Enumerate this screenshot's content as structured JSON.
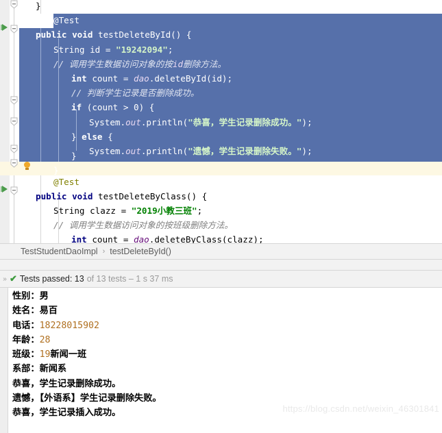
{
  "editor": {
    "lines": [
      {
        "y": -2,
        "indent": 52,
        "selected": false,
        "tokens": [
          {
            "c": "plain",
            "t": "}"
          }
        ]
      },
      {
        "y": 19.2,
        "indent": 78,
        "selected": true,
        "selstart": 78,
        "tokens": [
          {
            "c": "anno",
            "t": "@Test"
          }
        ]
      },
      {
        "y": 40.4,
        "indent": 52,
        "selected": true,
        "tokens": [
          {
            "c": "kw",
            "t": "public void "
          },
          {
            "c": "plain",
            "t": "testDeleteById() {"
          }
        ]
      },
      {
        "y": 61.6,
        "indent": 78,
        "selected": true,
        "tokens": [
          {
            "c": "plain",
            "t": "String id = "
          },
          {
            "c": "str",
            "t": "\"19242094\""
          },
          {
            "c": "plain",
            "t": ";"
          }
        ]
      },
      {
        "y": 82.8,
        "indent": 78,
        "selected": true,
        "tokens": [
          {
            "c": "cmt",
            "t": "// 调用学生数据访问对象的按"
          },
          {
            "c": "fld",
            "t": "id"
          },
          {
            "c": "cmt",
            "t": "删除方法。"
          }
        ]
      },
      {
        "y": 104.0,
        "indent": 104,
        "selected": true,
        "tokens": [
          {
            "c": "kw",
            "t": "int "
          },
          {
            "c": "plain",
            "t": "count = "
          },
          {
            "c": "fld",
            "t": "dao"
          },
          {
            "c": "plain",
            "t": ".deleteById(id);"
          }
        ]
      },
      {
        "y": 125.2,
        "indent": 104,
        "selected": true,
        "tokens": [
          {
            "c": "cmt",
            "t": "// 判断学生记录是否删除成功。"
          }
        ]
      },
      {
        "y": 146.4,
        "indent": 104,
        "selected": true,
        "tokens": [
          {
            "c": "kw",
            "t": "if "
          },
          {
            "c": "plain",
            "t": "(count > 0) {"
          }
        ]
      },
      {
        "y": 167.6,
        "indent": 130,
        "selected": true,
        "tokens": [
          {
            "c": "plain",
            "t": "System."
          },
          {
            "c": "fld",
            "t": "out"
          },
          {
            "c": "plain",
            "t": ".println("
          },
          {
            "c": "str",
            "t": "\"恭喜，学生记录删除成功。\""
          },
          {
            "c": "plain",
            "t": ");"
          }
        ]
      },
      {
        "y": 188.8,
        "indent": 104,
        "selected": true,
        "tokens": [
          {
            "c": "plain",
            "t": "} "
          },
          {
            "c": "kw",
            "t": "else "
          },
          {
            "c": "plain",
            "t": "{"
          }
        ]
      },
      {
        "y": 210.0,
        "indent": 130,
        "selected": true,
        "tokens": [
          {
            "c": "plain",
            "t": "System."
          },
          {
            "c": "fld",
            "t": "out"
          },
          {
            "c": "plain",
            "t": ".println("
          },
          {
            "c": "str",
            "t": "\"遗憾，学生记录删除失败。\""
          },
          {
            "c": "plain",
            "t": ");"
          }
        ]
      },
      {
        "y": 217.2,
        "indent": 104,
        "selected": true,
        "tokens": [
          {
            "c": "plain",
            "t": "}"
          }
        ]
      },
      {
        "y": 238.4,
        "indent": 78,
        "selected": true,
        "tokens": [
          {
            "c": "plain",
            "t": "}"
          }
        ]
      },
      {
        "y": 254.6,
        "indent": 78,
        "selected": false,
        "tokens": [
          {
            "c": "anno",
            "t": "@Test"
          }
        ]
      },
      {
        "y": 275.8,
        "indent": 52,
        "selected": false,
        "tokens": [
          {
            "c": "kw",
            "t": "public void "
          },
          {
            "c": "plain",
            "t": "testDeleteByClass() {"
          }
        ]
      },
      {
        "y": 297.0,
        "indent": 78,
        "selected": false,
        "tokens": [
          {
            "c": "plain",
            "t": "String clazz = "
          },
          {
            "c": "str",
            "t": "\"2019小教三班\""
          },
          {
            "c": "plain",
            "t": ";"
          }
        ]
      },
      {
        "y": 318.2,
        "indent": 78,
        "selected": false,
        "tokens": [
          {
            "c": "cmt",
            "t": "// 调用学生数据访问对象的按班级删除方法。"
          }
        ]
      },
      {
        "y": 339.4,
        "indent": 104,
        "selected": false,
        "tokens": [
          {
            "c": "kw",
            "t": "int "
          },
          {
            "c": "plain",
            "t": "count = "
          },
          {
            "c": "fld",
            "t": "dao"
          },
          {
            "c": "plain",
            "t": ".deleteByClass(clazz);"
          }
        ]
      }
    ],
    "selection_color": "#5670aa",
    "caret_line_color": "#fdf8e3",
    "gutter_icons": {
      "run_arrow_label": "run-test-arrow",
      "fold_label": "code-fold-toggle",
      "bulb_label": "intention-bulb"
    }
  },
  "breadcrumb": {
    "class_name": "TestStudentDaoImpl",
    "separator": "›",
    "method_name": "testDeleteById()"
  },
  "test_status": {
    "chevron": "»",
    "check": "✔",
    "passed_label": "Tests passed: 13",
    "detail": "of 13 tests – 1 s 37 ms"
  },
  "console": {
    "lines": [
      [
        {
          "c": "cn",
          "t": "性别："
        },
        {
          "c": "cv",
          "t": "男"
        }
      ],
      [
        {
          "c": "cn",
          "t": "姓名："
        },
        {
          "c": "cv",
          "t": "易百"
        }
      ],
      [
        {
          "c": "cn",
          "t": "电话："
        },
        {
          "c": "cnum",
          "t": "18228015902"
        }
      ],
      [
        {
          "c": "cn",
          "t": "年龄："
        },
        {
          "c": "cnum",
          "t": "28"
        }
      ],
      [
        {
          "c": "cn",
          "t": "班级："
        },
        {
          "c": "cnum",
          "t": "19"
        },
        {
          "c": "cv",
          "t": "新闻一班"
        }
      ],
      [
        {
          "c": "cn",
          "t": "系部："
        },
        {
          "c": "cv",
          "t": "新闻系"
        }
      ],
      [
        {
          "c": "cv",
          "t": "恭喜，学生记录删除成功。"
        }
      ],
      [
        {
          "c": "cv",
          "t": "遗憾，【外语系】学生记录删除失败。"
        }
      ],
      [
        {
          "c": "cv",
          "t": "恭喜，学生记录插入成功。"
        }
      ]
    ]
  },
  "watermark": {
    "text": "https://blog.csdn.net/weixin_46301841"
  }
}
